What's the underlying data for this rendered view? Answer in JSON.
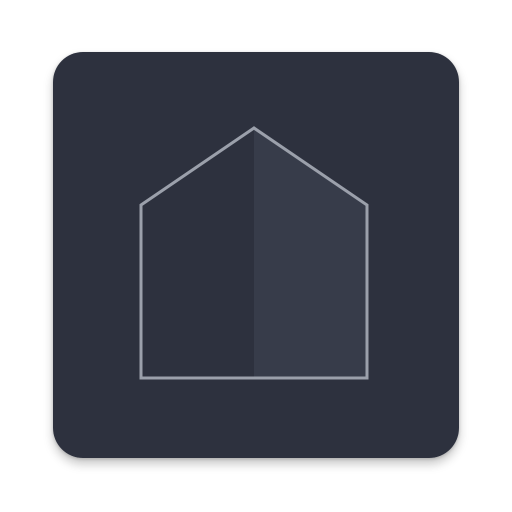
{
  "app_icon": {
    "icon": "home-icon",
    "colors": {
      "tile_background": "#2d313e",
      "house_left_fill": "#2d313e",
      "house_right_fill": "#373c4a",
      "house_outline": "#9ba0ab"
    }
  }
}
